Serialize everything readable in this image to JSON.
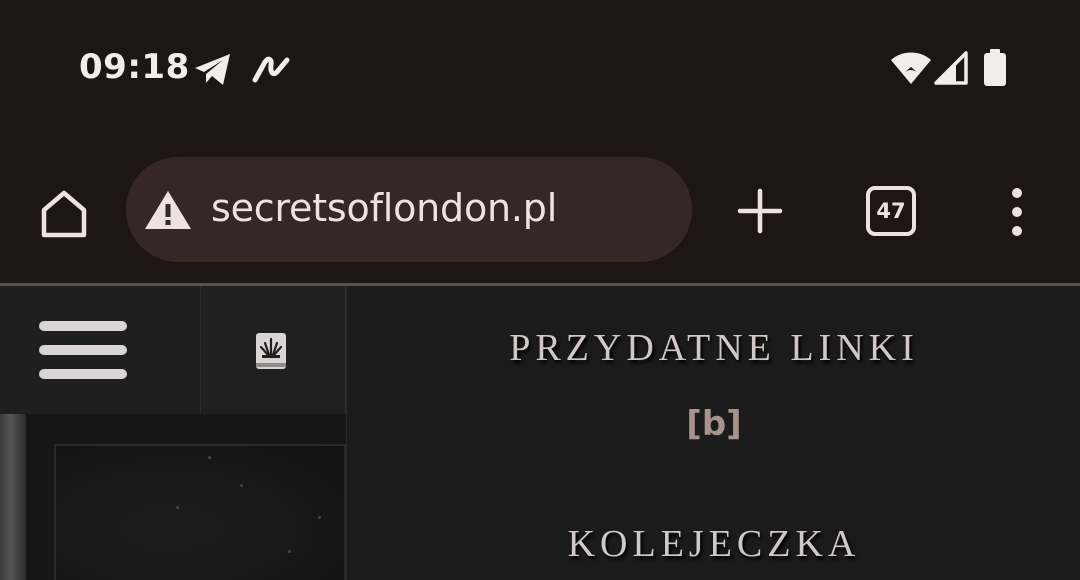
{
  "status_bar": {
    "time": "09:18",
    "left_icons": [
      "telegram-icon",
      "activity-icon"
    ],
    "right_icons": [
      "wifi-icon",
      "signal-icon",
      "battery-icon"
    ]
  },
  "browser": {
    "url": "secretsoflondon.pl",
    "security_icon": "warning-icon",
    "tab_count": "47",
    "buttons": [
      "home-icon",
      "new-tab-icon",
      "tab-switcher",
      "overflow-menu-icon"
    ]
  },
  "page": {
    "menu_icon": "hamburger-icon",
    "secondary_icon": "book-icon",
    "section_heading": "PRZYDATNE LINKI",
    "link_label": "[b]",
    "next_heading": "KOLEJECZKA"
  },
  "colors": {
    "chrome_bg": "#1e1614",
    "url_pill_bg": "#352824",
    "page_bg": "#1b1b1b",
    "heading_text": "#cfc8c6",
    "link_text": "#a8928c"
  }
}
